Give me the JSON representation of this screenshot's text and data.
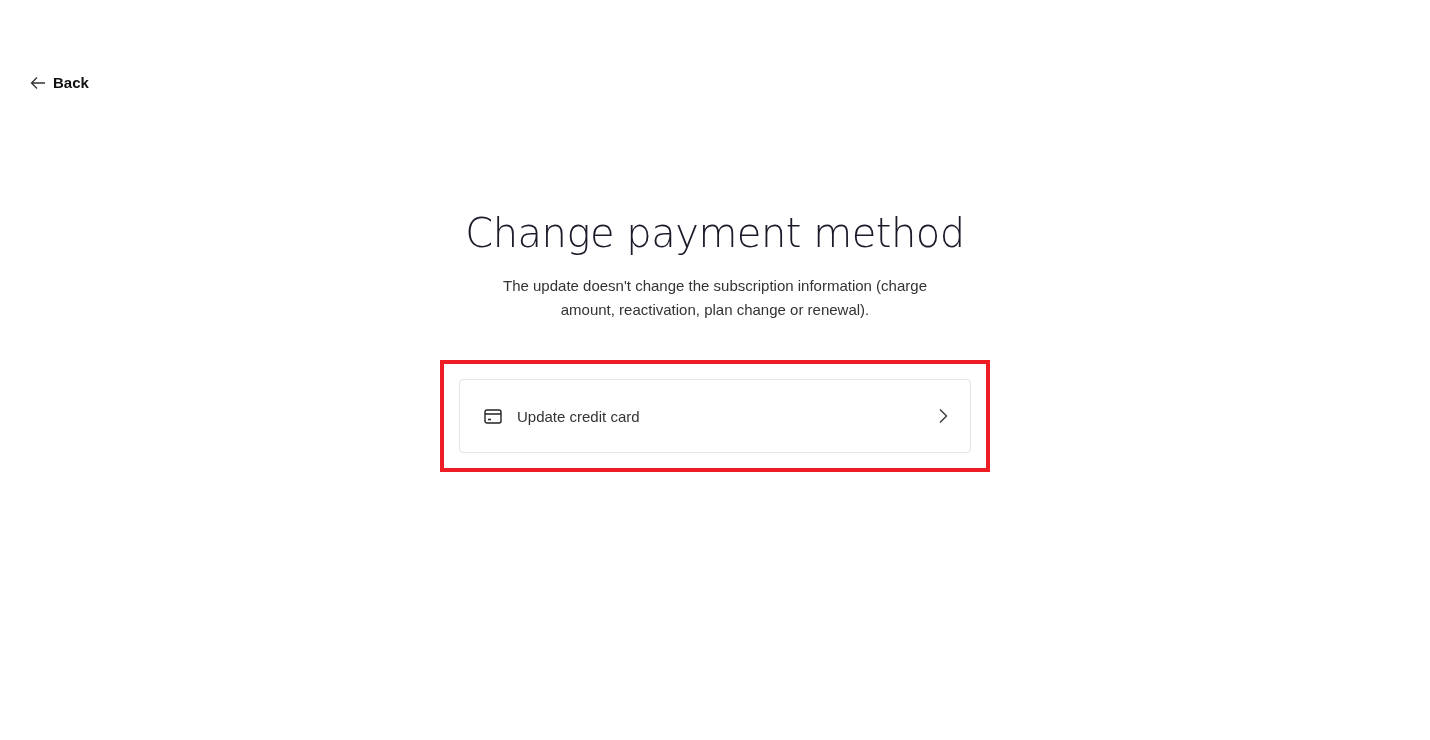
{
  "back": {
    "label": "Back"
  },
  "title": "Change payment method",
  "description": "The update doesn't change the subscription information (charge amount, reactivation, plan change or renewal).",
  "options": [
    {
      "kind": "card",
      "label": "Update credit card",
      "highlighted": true
    }
  ]
}
